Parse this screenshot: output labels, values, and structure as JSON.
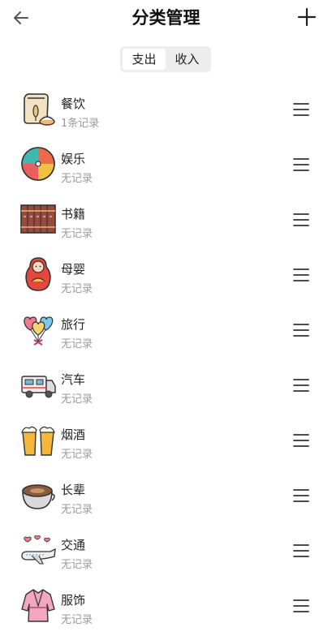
{
  "header": {
    "title": "分类管理"
  },
  "tabs": {
    "expense_label": "支出",
    "income_label": "收入"
  },
  "categories": [
    {
      "name": "餐饮",
      "sub": "1条记录",
      "icon": "food-bag-icon"
    },
    {
      "name": "娱乐",
      "sub": "无记录",
      "icon": "beach-ball-icon"
    },
    {
      "name": "书籍",
      "sub": "无记录",
      "icon": "books-icon"
    },
    {
      "name": "母婴",
      "sub": "无记录",
      "icon": "matryoshka-doll-icon"
    },
    {
      "name": "旅行",
      "sub": "无记录",
      "icon": "heart-balloons-icon"
    },
    {
      "name": "汽车",
      "sub": "无记录",
      "icon": "camper-van-icon"
    },
    {
      "name": "烟酒",
      "sub": "无记录",
      "icon": "beer-mugs-icon"
    },
    {
      "name": "长辈",
      "sub": "无记录",
      "icon": "coffee-cup-icon"
    },
    {
      "name": "交通",
      "sub": "无记录",
      "icon": "airplane-icon"
    },
    {
      "name": "服饰",
      "sub": "无记录",
      "icon": "robe-icon"
    }
  ]
}
